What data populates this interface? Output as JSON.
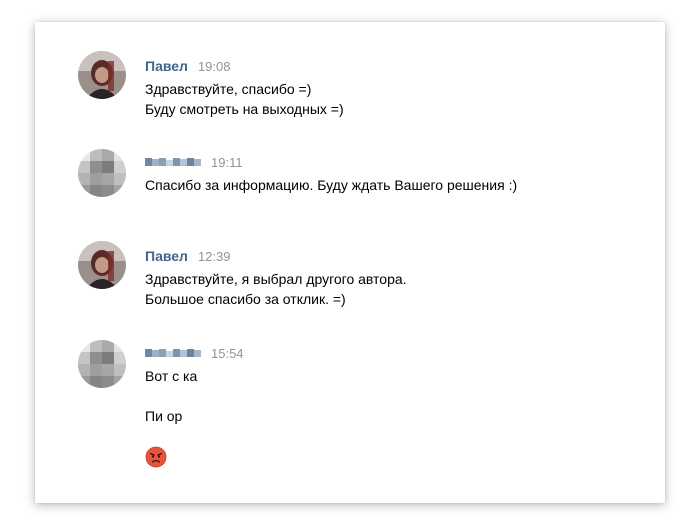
{
  "messages": [
    {
      "author": "Павел",
      "time": "19:08",
      "lines": [
        "Здравствуйте, спасибо =)",
        "Буду смотреть на выходных =)"
      ]
    },
    {
      "author": "",
      "author_blurred": true,
      "time": "19:11",
      "lines": [
        "Спасибо за информацию. Буду ждать Вашего решения :)"
      ]
    },
    {
      "author": "Павел",
      "time": "12:39",
      "lines": [
        "Здравствуйте, я выбрал другого автора.",
        "Большое спасибо за отклик. =)"
      ]
    },
    {
      "author": "",
      "author_blurred": true,
      "time": "15:54",
      "lines": [
        "Вот с  ка",
        "Пи  ор"
      ],
      "emoji": "angry-face-icon"
    }
  ],
  "colors": {
    "author": "#42648b",
    "time": "#939393",
    "text": "#000000"
  }
}
